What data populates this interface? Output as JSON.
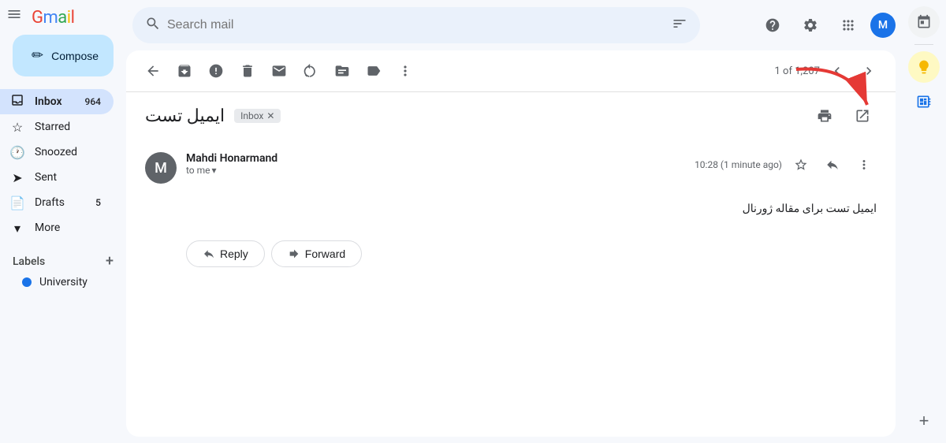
{
  "app": {
    "title": "Gmail",
    "logo": "Gmail"
  },
  "topbar": {
    "search_placeholder": "Search mail",
    "help_icon": "?",
    "settings_icon": "⚙",
    "apps_icon": "⠿"
  },
  "sidebar": {
    "compose_label": "Compose",
    "nav_items": [
      {
        "id": "inbox",
        "label": "Inbox",
        "badge": "964",
        "active": true
      },
      {
        "id": "starred",
        "label": "Starred",
        "badge": ""
      },
      {
        "id": "snoozed",
        "label": "Snoozed",
        "badge": ""
      },
      {
        "id": "sent",
        "label": "Sent",
        "badge": ""
      },
      {
        "id": "drafts",
        "label": "Drafts",
        "badge": "5"
      },
      {
        "id": "more",
        "label": "More",
        "badge": ""
      }
    ],
    "labels_header": "Labels",
    "labels": [
      {
        "id": "university",
        "label": "University"
      }
    ]
  },
  "email": {
    "pagination": "1 of 1,207",
    "subject": "ایمیل تست",
    "inbox_tag": "Inbox",
    "sender_name": "Mahdi Honarmand",
    "sender_initial": "M",
    "to_label": "to me",
    "time": "10:28 (1 minute ago)",
    "body_text": "ایمیل تست برای مقاله ژورنال",
    "reply_label": "Reply",
    "forward_label": "Forward"
  },
  "right_panel": {
    "add_label": "+"
  }
}
